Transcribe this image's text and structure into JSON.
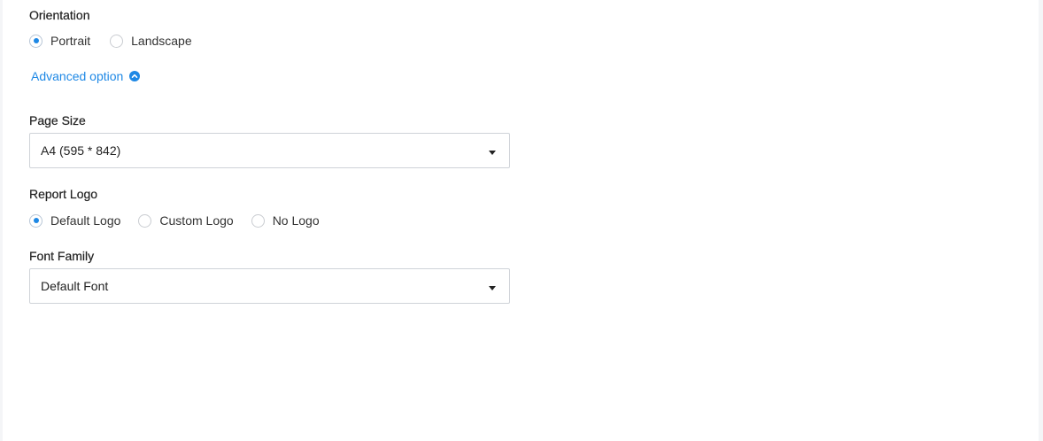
{
  "orientation": {
    "label": "Orientation",
    "options": [
      {
        "label": "Portrait",
        "checked": true
      },
      {
        "label": "Landscape",
        "checked": false
      }
    ]
  },
  "advanced": {
    "label": "Advanced option",
    "icon": "chevron-up-circle-icon"
  },
  "page_size": {
    "label": "Page Size",
    "value": "A4 (595 * 842)",
    "icon": "caret-down-icon"
  },
  "report_logo": {
    "label": "Report Logo",
    "options": [
      {
        "label": "Default Logo",
        "checked": true
      },
      {
        "label": "Custom Logo",
        "checked": false
      },
      {
        "label": "No Logo",
        "checked": false
      }
    ]
  },
  "font_family": {
    "label": "Font Family",
    "value": "Default Font",
    "icon": "caret-down-icon"
  },
  "colors": {
    "accent": "#1e88e5",
    "panel_bg": "#ffffff",
    "page_bg": "#f4f5f7"
  }
}
